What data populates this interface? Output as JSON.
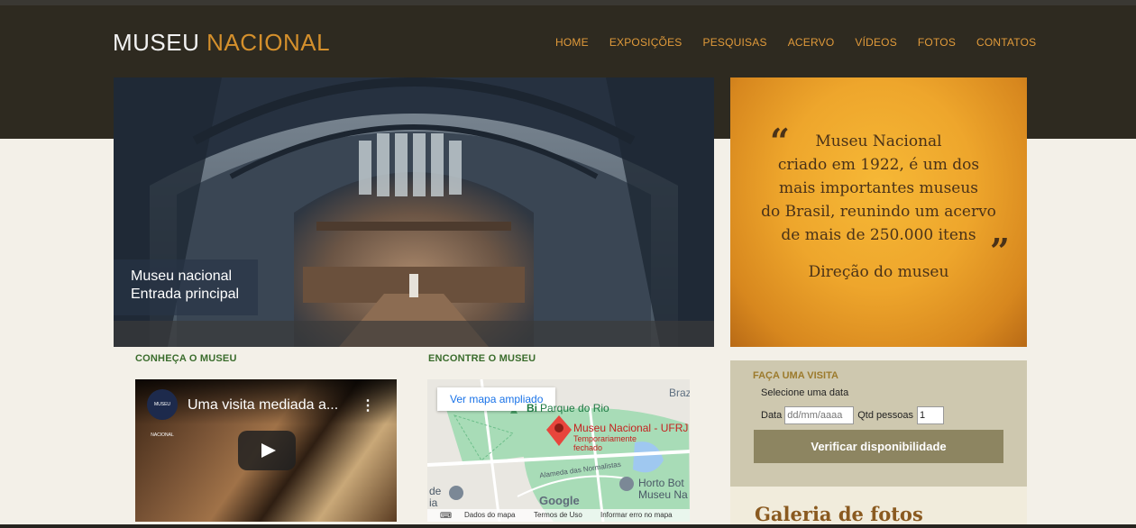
{
  "header": {
    "logo_part1": "MUSEU",
    "logo_part2": "NACIONAL",
    "nav": [
      "HOME",
      "EXPOSIÇÕES",
      "PESQUISAS",
      "ACERVO",
      "VÍDEOS",
      "FOTOS",
      "CONTATOS"
    ]
  },
  "hero": {
    "caption_line1": "Museu nacional",
    "caption_line2": "Entrada principal"
  },
  "quote": {
    "open_mark": "“",
    "close_mark": "”",
    "lines": [
      "Museu Nacional",
      "criado em 1922, é um dos",
      "mais importantes museus",
      "do Brasil, reunindo um acervo",
      "de mais de 250.000 itens"
    ],
    "signature": "Direção do museu"
  },
  "sections": {
    "video_title": "CONHEÇA O MUSEU",
    "map_title": "ENCONTRE O MUSEU"
  },
  "video": {
    "channel_logo": "MUSEU NACIONAL",
    "title": "Uma visita mediada a...",
    "menu_icon": "⋮"
  },
  "map": {
    "button": "Ver mapa ampliado",
    "place_park": "Parque do Rio",
    "place_park_prefix": "Bi",
    "place_name": "Museu Nacional - UFRJ",
    "place_status1": "Temporariamente",
    "place_status2": "fechado",
    "street": "Alameda das Normalistas",
    "place_horto": "Horto Bot",
    "place_horto2": "Museu Na",
    "edge_text": "Braz",
    "edge_de": "de",
    "edge_ia": "ia",
    "google": "Google",
    "footer": [
      "Dados do mapa",
      "Termos de Uso",
      "Informar erro no mapa"
    ]
  },
  "visit": {
    "title": "FAÇA UMA VISITA",
    "subtitle": "Selecione uma data",
    "date_label": "Data",
    "date_placeholder": "dd/mm/aaaa",
    "qtd_label": "Qtd pessoas",
    "qtd_value": "1",
    "verify_button": "Verificar disponibilidade"
  },
  "gallery": {
    "title": "Galeria de fotos"
  }
}
